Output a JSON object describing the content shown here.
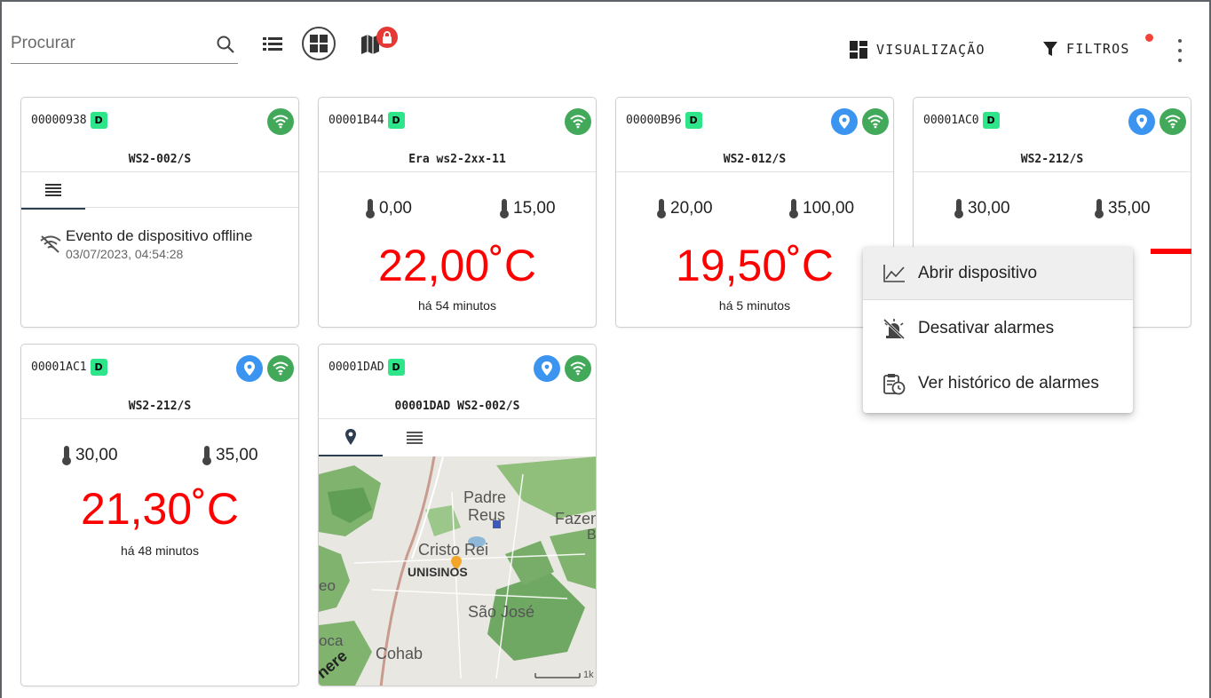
{
  "toolbar": {
    "search_placeholder": "Procurar",
    "lock_badge_color": "#e53935",
    "visualizacao_label": "VISUALIZAÇÃO",
    "filtros_label": "FILTROS"
  },
  "cards": [
    {
      "id": "00000938",
      "badge": "D",
      "name": "WS2-002/S",
      "offline_event": "Evento de dispositivo offline",
      "offline_time": "03/07/2023, 04:54:28"
    },
    {
      "id": "00001B44",
      "badge": "D",
      "name": "Era ws2-2xx-11",
      "min": "0,00",
      "max": "15,00",
      "temp": "22,00˚C",
      "ago": "há 54 minutos"
    },
    {
      "id": "00000B96",
      "badge": "D",
      "name": "WS2-012/S",
      "min": "20,00",
      "max": "100,00",
      "temp": "19,50˚C",
      "ago": "há 5 minutos"
    },
    {
      "id": "00001AC0",
      "badge": "D",
      "name": "WS2-212/S",
      "min": "30,00",
      "max": "35,00"
    },
    {
      "id": "00001AC1",
      "badge": "D",
      "name": "WS2-212/S",
      "min": "30,00",
      "max": "35,00",
      "temp": "21,30˚C",
      "ago": "há 48 minutos"
    },
    {
      "id": "00001DAD",
      "badge": "D",
      "name": "00001DAD WS2-002/S"
    }
  ],
  "map_labels": {
    "padre": "Padre",
    "reus": "Reus",
    "faze": "Fazen",
    "b": "B",
    "cristo_rei": "Cristo Rei",
    "unisinos": "UNISINOS",
    "eo": "eo",
    "sao_jose": "São José",
    "oca": "oca",
    "cohab": "Cohab",
    "here": "here",
    "scale": "1k"
  },
  "context_menu": {
    "open_device": "Abrir dispositivo",
    "disable_alarms": "Desativar alarmes",
    "alarm_history": "Ver histórico de alarmes"
  },
  "colors": {
    "temp_red": "#ff0000",
    "badge_green": "#2ee58a",
    "wifi_green": "#43a95a",
    "location_blue": "#3b94f0"
  }
}
